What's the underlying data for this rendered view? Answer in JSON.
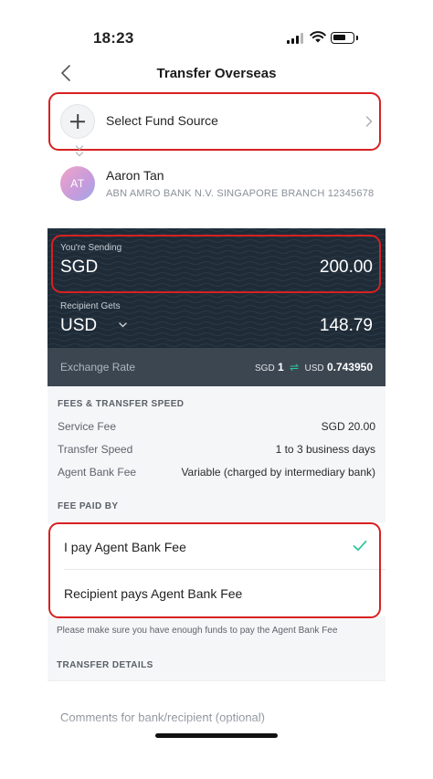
{
  "status_bar": {
    "time": "18:23"
  },
  "nav": {
    "title": "Transfer Overseas"
  },
  "fund_source": {
    "label": "Select Fund Source"
  },
  "recipient": {
    "initials": "AT",
    "name": "Aaron Tan",
    "bank_line": "ABN AMRO BANK N.V. SINGAPORE BRANCH  12345678"
  },
  "sending": {
    "label": "You're Sending",
    "currency": "SGD",
    "amount": "200.00"
  },
  "receiving": {
    "label": "Recipient Gets",
    "currency": "USD",
    "amount": "148.79"
  },
  "exchange_rate": {
    "label": "Exchange Rate",
    "from_ccy": "SGD",
    "from_amt": "1",
    "to_ccy": "USD",
    "to_amt": "0.743950"
  },
  "fees": {
    "heading": "FEES & TRANSFER SPEED",
    "rows": [
      {
        "label": "Service Fee",
        "value": "SGD 20.00"
      },
      {
        "label": "Transfer Speed",
        "value": "1 to 3 business days"
      },
      {
        "label": "Agent Bank Fee",
        "value": "Variable (charged by intermediary bank)"
      }
    ]
  },
  "fee_paid_by": {
    "heading": "FEE PAID BY",
    "options": [
      {
        "label": "I pay Agent Bank Fee",
        "selected": true
      },
      {
        "label": "Recipient pays Agent Bank Fee",
        "selected": false
      }
    ],
    "note": "Please make sure you have enough funds to pay the Agent Bank Fee"
  },
  "transfer_details": {
    "heading": "TRANSFER DETAILS",
    "comments_placeholder": "Comments for bank/recipient (optional)"
  },
  "colors": {
    "highlight": "#d82020",
    "panel_dark": "#1f2c38",
    "rate_strip": "#3b4651",
    "accent_green": "#2cc79a"
  }
}
